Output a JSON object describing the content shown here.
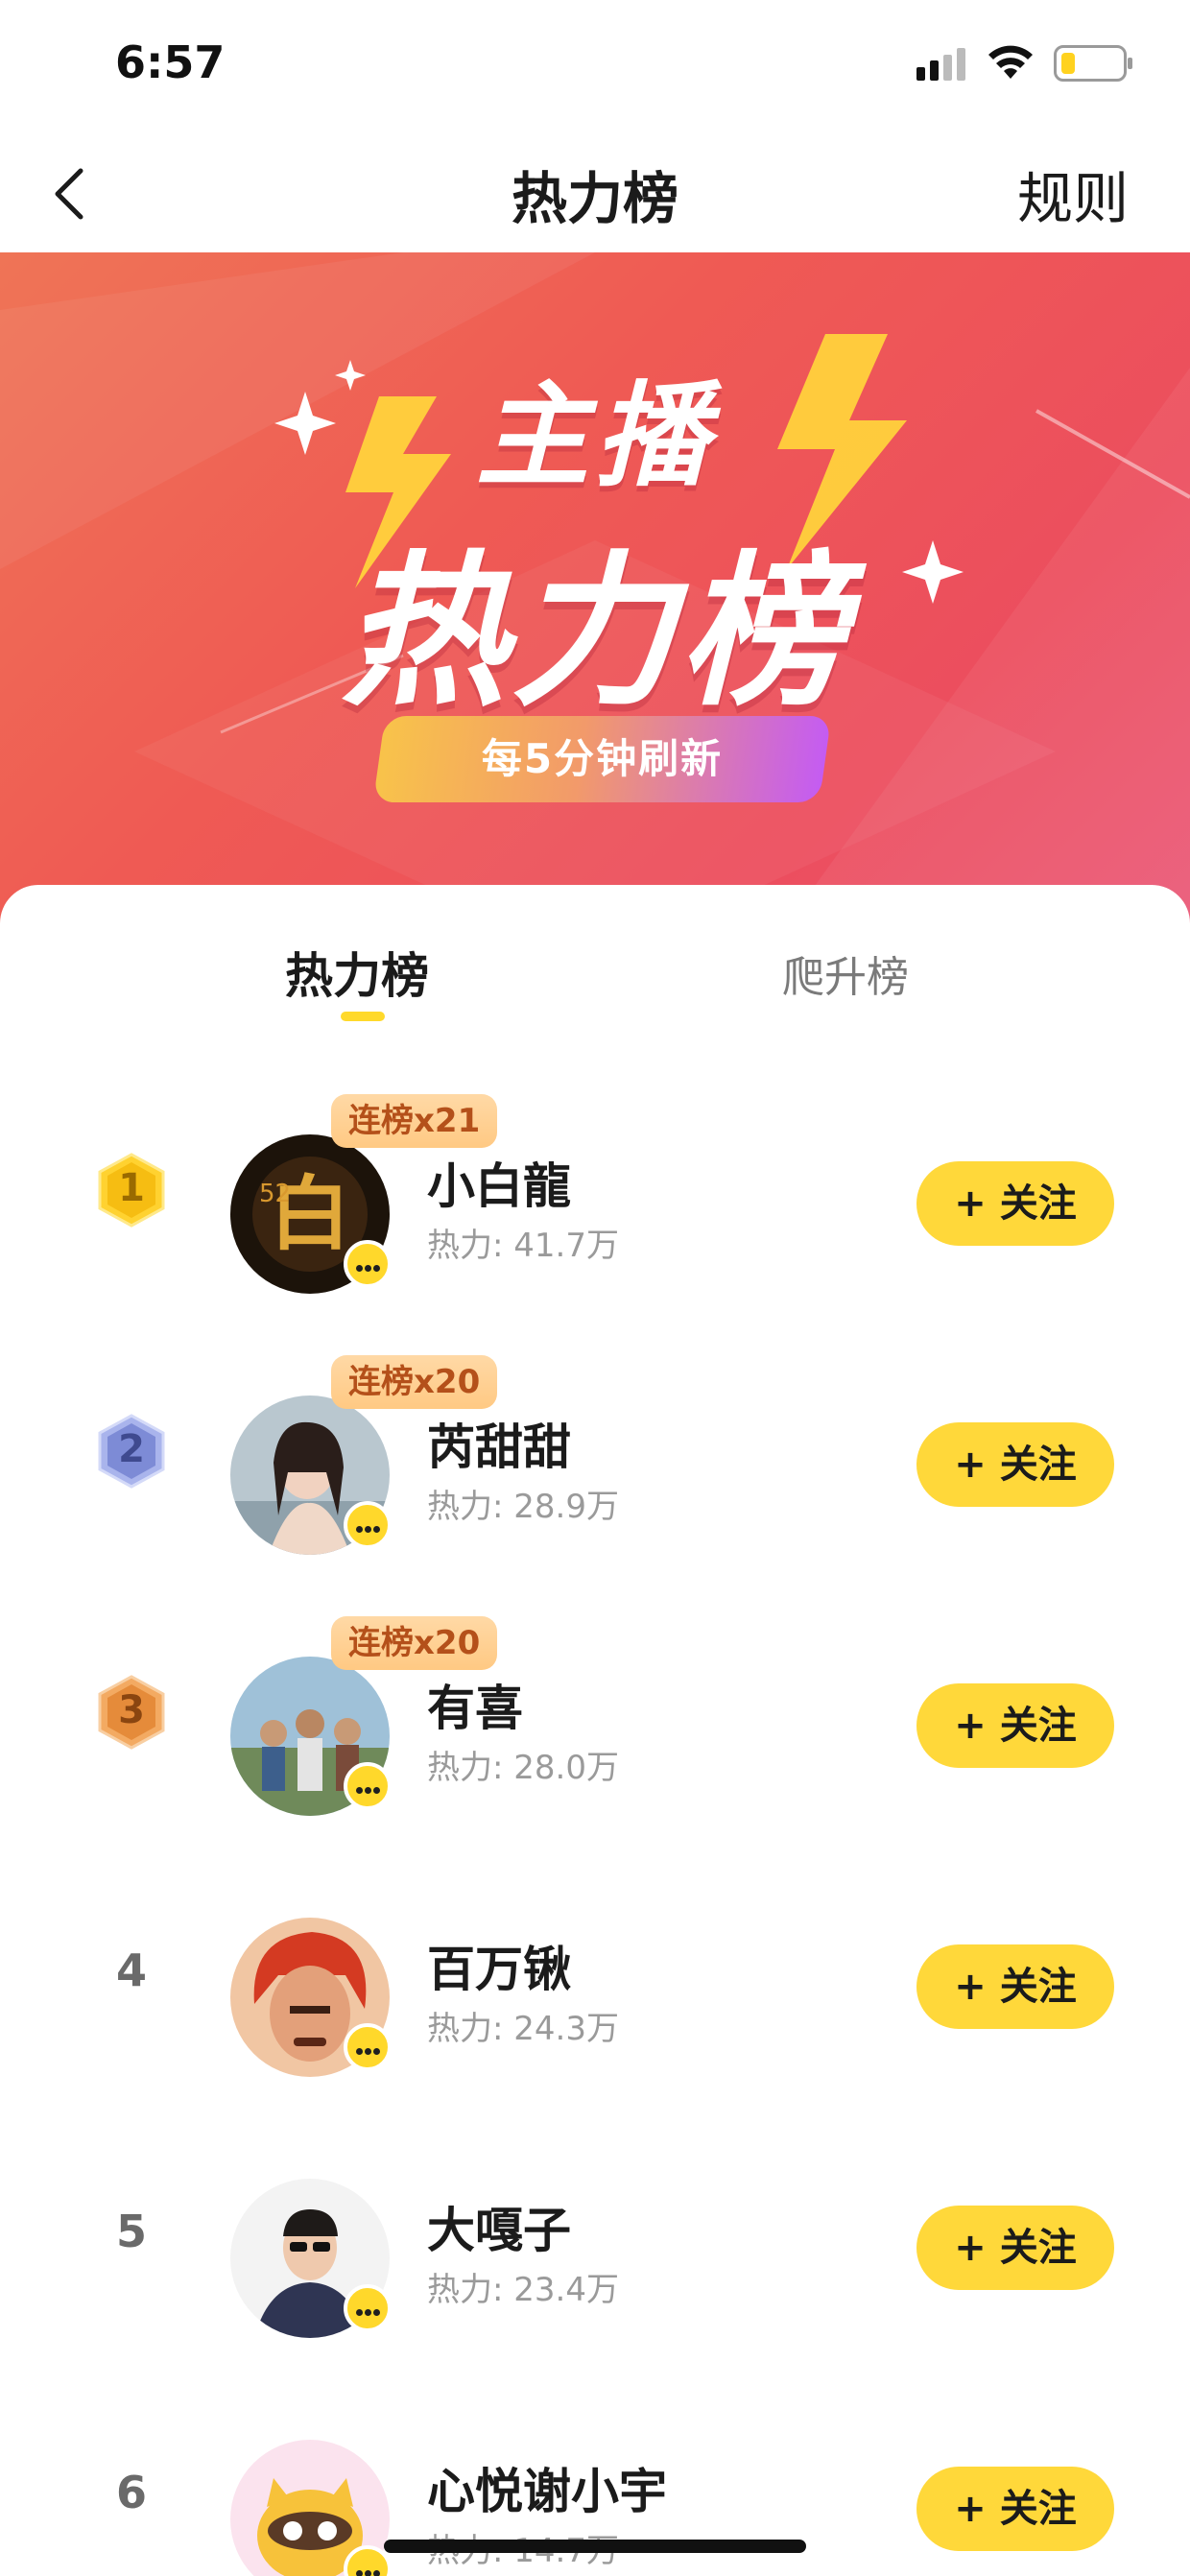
{
  "status_bar": {
    "time": "6:57"
  },
  "nav": {
    "title": "热力榜",
    "rules": "规则"
  },
  "banner": {
    "title_line1": "主播",
    "title_line2": "热力榜",
    "refresh_note": "每5分钟刷新"
  },
  "tabs": [
    {
      "label": "热力榜",
      "active": true
    },
    {
      "label": "爬升榜",
      "active": false
    }
  ],
  "colors": {
    "accent": "#ffd83a",
    "streak_text": "#b4501a",
    "banner": "#ef5a54"
  },
  "follow_label": "+ 关注",
  "ranking": [
    {
      "rank": "1",
      "name": "小白龍",
      "heat": "热力: 41.7万",
      "streak": "连榜x21"
    },
    {
      "rank": "2",
      "name": "芮甜甜",
      "heat": "热力: 28.9万",
      "streak": "连榜x20"
    },
    {
      "rank": "3",
      "name": "有喜",
      "heat": "热力: 28.0万",
      "streak": "连榜x20"
    },
    {
      "rank": "4",
      "name": "百万锹",
      "heat": "热力: 24.3万",
      "streak": ""
    },
    {
      "rank": "5",
      "name": "大嘎子",
      "heat": "热力: 23.4万",
      "streak": ""
    },
    {
      "rank": "6",
      "name": "心悦谢小宇",
      "heat": "热力: 14.7万",
      "streak": ""
    }
  ]
}
